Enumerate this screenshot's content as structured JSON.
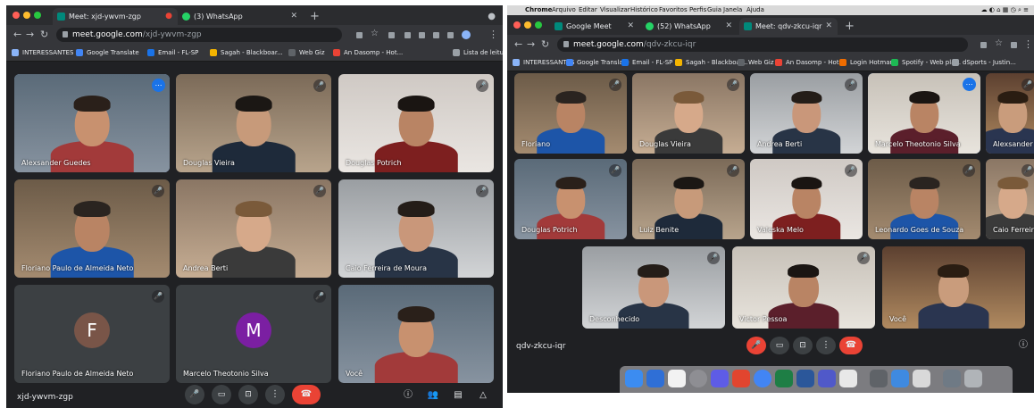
{
  "left": {
    "tabs": [
      {
        "label": "Meet: xjd-ywvm-zgp",
        "fav_color": "#00897b",
        "active": true
      },
      {
        "label": "(3) WhatsApp",
        "fav_color": "#25d366",
        "active": false
      }
    ],
    "url_host": "meet.google.com",
    "url_path": "/xjd-ywvm-zgp",
    "bookmarks": [
      {
        "label": "INTERESSANTES",
        "color": "#8ab4f8"
      },
      {
        "label": "Google Translate",
        "color": "#4285f4"
      },
      {
        "label": "Email - FL-SP",
        "color": "#1a73e8"
      },
      {
        "label": "Sagah - Blackboar...",
        "color": "#f4b400"
      },
      {
        "label": "Web Giz",
        "color": "#5f6368"
      },
      {
        "label": "An Dasomp - Hot...",
        "color": "#ea4335"
      },
      {
        "label": "Lista de leitura",
        "color": "#9aa0a6"
      }
    ],
    "tiles": [
      {
        "name": "Alexsander Guedes"
      },
      {
        "name": "Douglas Vieira"
      },
      {
        "name": "Douglas Potrich"
      },
      {
        "name": "Floriano Paulo de Almeida Neto"
      },
      {
        "name": "Andrea Berti"
      },
      {
        "name": "Caio Ferreira de Moura"
      },
      {
        "name": "Floriano Paulo de Almeida Neto",
        "initial": "F",
        "avatar_color": "#795548"
      },
      {
        "name": "Marcelo Theotonio Silva",
        "initial": "M",
        "avatar_color": "#7b1fa2"
      },
      {
        "name": "Você"
      }
    ],
    "meeting_code": "xjd-ywvm-zgp"
  },
  "right": {
    "menubar": [
      "Chrome",
      "Arquivo",
      "Editar",
      "Visualizar",
      "Histórico",
      "Favoritos",
      "Perfis",
      "Guia",
      "Janela",
      "Ajuda"
    ],
    "tabs": [
      {
        "label": "Google Meet",
        "fav_color": "#00897b",
        "active": false
      },
      {
        "label": "(52) WhatsApp",
        "fav_color": "#25d366",
        "active": false
      },
      {
        "label": "Meet: qdv-zkcu-iqr",
        "fav_color": "#00897b",
        "active": true
      }
    ],
    "url_host": "meet.google.com",
    "url_path": "/qdv-zkcu-iqr",
    "bookmarks": [
      {
        "label": "INTERESSANTES",
        "color": "#8ab4f8"
      },
      {
        "label": "Google Translate",
        "color": "#4285f4"
      },
      {
        "label": "Email - FL-SP",
        "color": "#1a73e8"
      },
      {
        "label": "Sagah - Blackboar...",
        "color": "#f4b400"
      },
      {
        "label": "Web Giz",
        "color": "#5f6368"
      },
      {
        "label": "An Dasomp - Hot...",
        "color": "#ea4335"
      },
      {
        "label": "Login Hotmart",
        "color": "#ef6c00"
      },
      {
        "label": "Spotify - Web pla...",
        "color": "#1db954"
      },
      {
        "label": "dSports - Justin...",
        "color": "#9aa0a6"
      }
    ],
    "tiles": [
      {
        "name": "Floriano"
      },
      {
        "name": "Douglas Vieira"
      },
      {
        "name": "Andrea Berti"
      },
      {
        "name": "Marcelo Theotonio Silva"
      },
      {
        "name": "Alexsander G"
      },
      {
        "name": "Douglas Potrich"
      },
      {
        "name": "Luiz Benite"
      },
      {
        "name": "Valeska Melo"
      },
      {
        "name": "Leonardo Goes de Souza"
      },
      {
        "name": "Caio Ferreira de"
      },
      {
        "name": "Desconhecido"
      },
      {
        "name": "Victor Pessoa"
      },
      {
        "name": "Você"
      }
    ],
    "meeting_code": "qdv-zkcu-iqr"
  }
}
